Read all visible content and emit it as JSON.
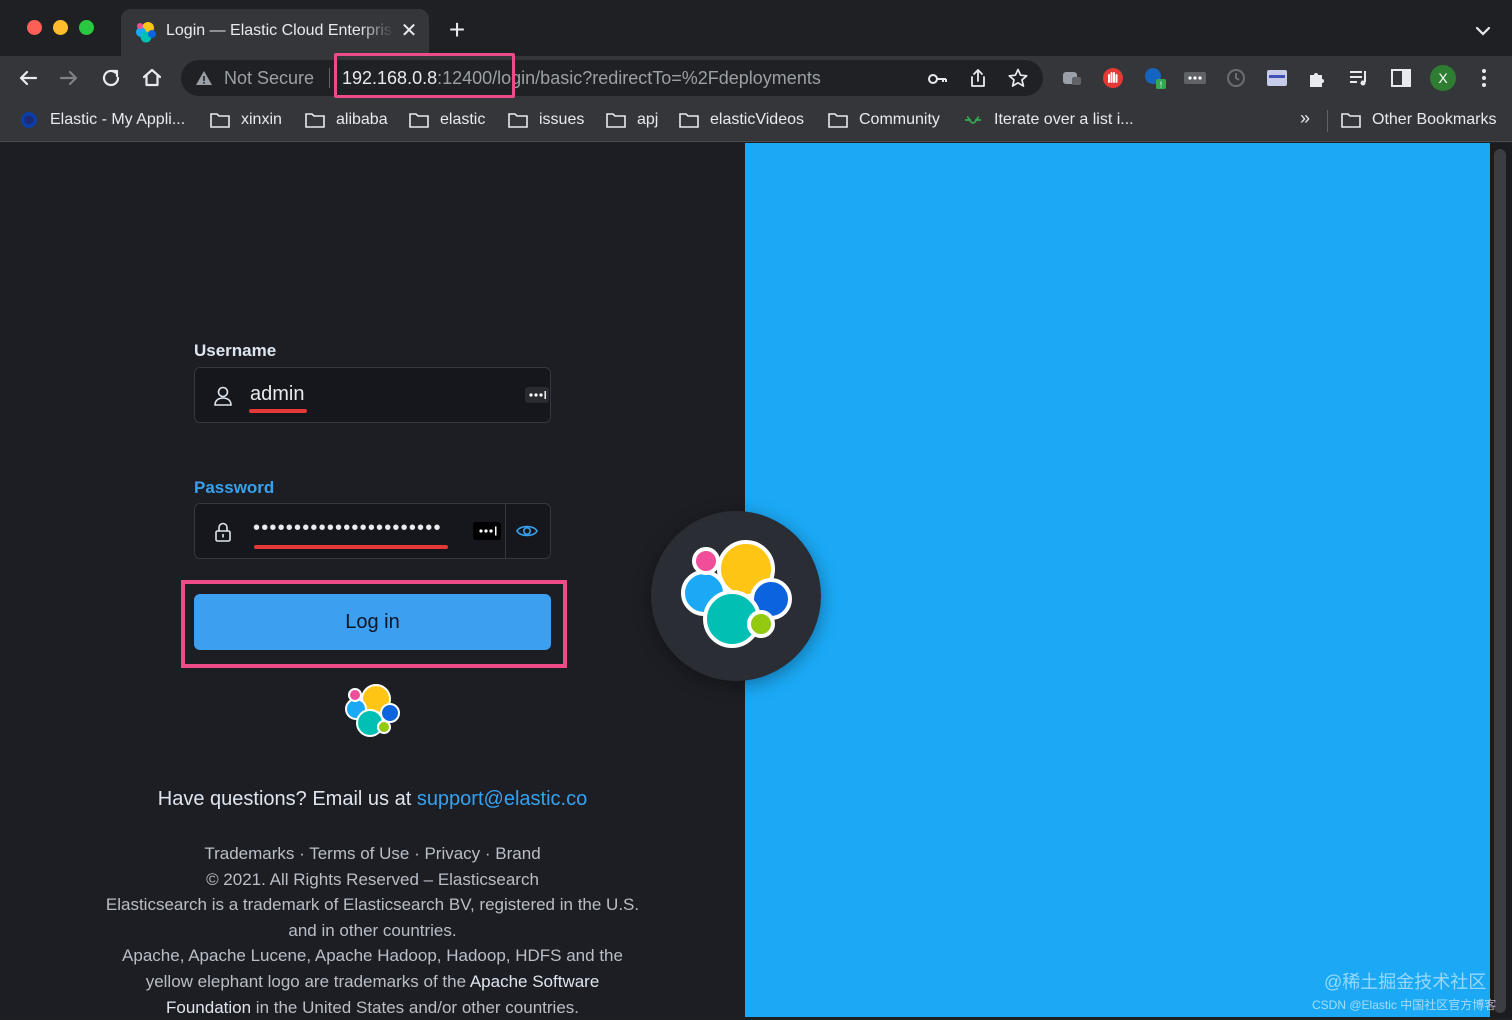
{
  "browser": {
    "tab": {
      "title": "Login — Elastic Cloud Enterprise",
      "close_glyph": "✕"
    },
    "new_tab_glyph": "+",
    "omnibox": {
      "security_label": "Not Secure",
      "url_host": "192.168.0.8",
      "url_rest": ":12400/login/basic?redirectTo=%2Fdeployments"
    },
    "profile_initial": "X",
    "bookmarks": [
      {
        "label": "Elastic - My Appli...",
        "icon": "elastic-favicon"
      },
      {
        "label": "xinxin",
        "icon": "folder-icon"
      },
      {
        "label": "alibaba",
        "icon": "folder-icon"
      },
      {
        "label": "elastic",
        "icon": "folder-icon"
      },
      {
        "label": "issues",
        "icon": "folder-icon"
      },
      {
        "label": "apj",
        "icon": "folder-icon"
      },
      {
        "label": "elasticVideos",
        "icon": "folder-icon"
      },
      {
        "label": "Community",
        "icon": "folder-icon"
      },
      {
        "label": "Iterate over a list i...",
        "icon": "link-favicon"
      }
    ],
    "bookmarks_overflow": "»",
    "other_bookmarks": "Other Bookmarks"
  },
  "login": {
    "username_label": "Username",
    "username_value": "admin",
    "password_label": "Password",
    "password_value": "•••••••••••••••••••••••",
    "submit_label": "Log in",
    "questions_text": "Have questions? Email us at ",
    "support_email": "support@elastic.co"
  },
  "footer": {
    "links": [
      "Trademarks",
      "Terms of Use",
      "Privacy",
      "Brand"
    ],
    "separator": " · ",
    "copyright": "© 2021. All Rights Reserved – Elasticsearch",
    "trademark_line1": "Elasticsearch is a trademark of Elasticsearch BV, registered in the U.S.",
    "trademark_line2": "and in other countries.",
    "apache_line1": "Apache, Apache Lucene, Apache Hadoop, Hadoop, HDFS and the",
    "apache_line2a": "yellow elephant logo are trademarks of the ",
    "apache_line2b": "Apache Software",
    "apache_line3a": "Foundation",
    "apache_line3b": " in the United States and/or other countries."
  },
  "watermark": {
    "line1": "@稀土掘金技术社区",
    "line2": "CSDN @Elastic 中国社区官方博客"
  },
  "colors": {
    "highlight_box": "#ec4c8a",
    "annotation_underline": "#e53935",
    "primary_button": "#3c9fef",
    "right_pane": "#1ba9f5",
    "link": "#36a2ef"
  }
}
